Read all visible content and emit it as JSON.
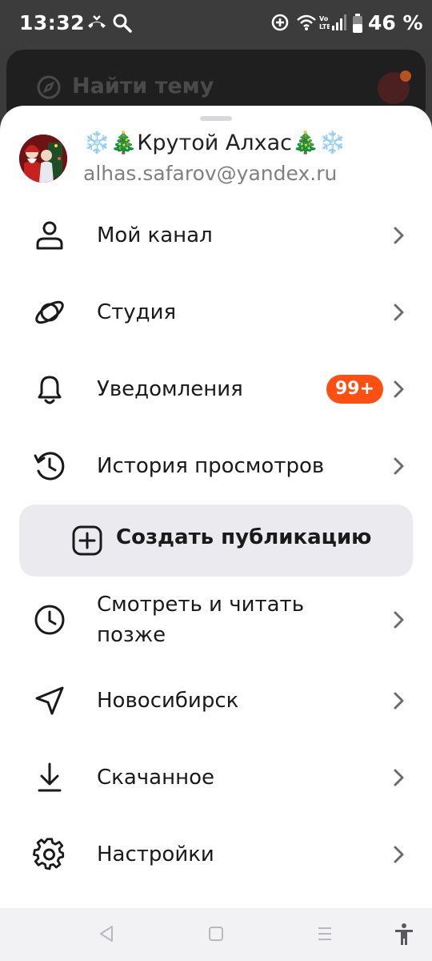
{
  "status_bar": {
    "time": "13:32",
    "battery": "46 %",
    "icons": [
      "missed-call-icon",
      "search-icon",
      "data-saver-icon",
      "wifi-icon",
      "volte-icon",
      "signal-icon",
      "battery-icon"
    ]
  },
  "background": {
    "search_placeholder": "Найти тему"
  },
  "profile": {
    "name": "❄️🎄Крутой Алхас🎄❄️",
    "email": "alhas.safarov@yandex.ru"
  },
  "menu": {
    "items": [
      {
        "label": "Мой канал",
        "icon": "person-icon"
      },
      {
        "label": "Студия",
        "icon": "studio-orbit-icon"
      },
      {
        "label": "Уведомления",
        "icon": "bell-icon",
        "badge": "99+"
      },
      {
        "label": "История просмотров",
        "icon": "history-icon"
      },
      {
        "label": "Смотреть и читать",
        "label2": "позже",
        "icon": "clock-icon"
      },
      {
        "label": "Новосибирск",
        "icon": "location-arrow-icon"
      },
      {
        "label": "Скачанное",
        "icon": "download-icon"
      },
      {
        "label": "Настройки",
        "icon": "gear-icon"
      }
    ],
    "create_label": "Создать публикацию"
  },
  "colors": {
    "badge": "#fe4f12",
    "create_button_bg": "#ebebef",
    "text_primary": "#1a1a1a",
    "text_secondary": "#808080"
  }
}
